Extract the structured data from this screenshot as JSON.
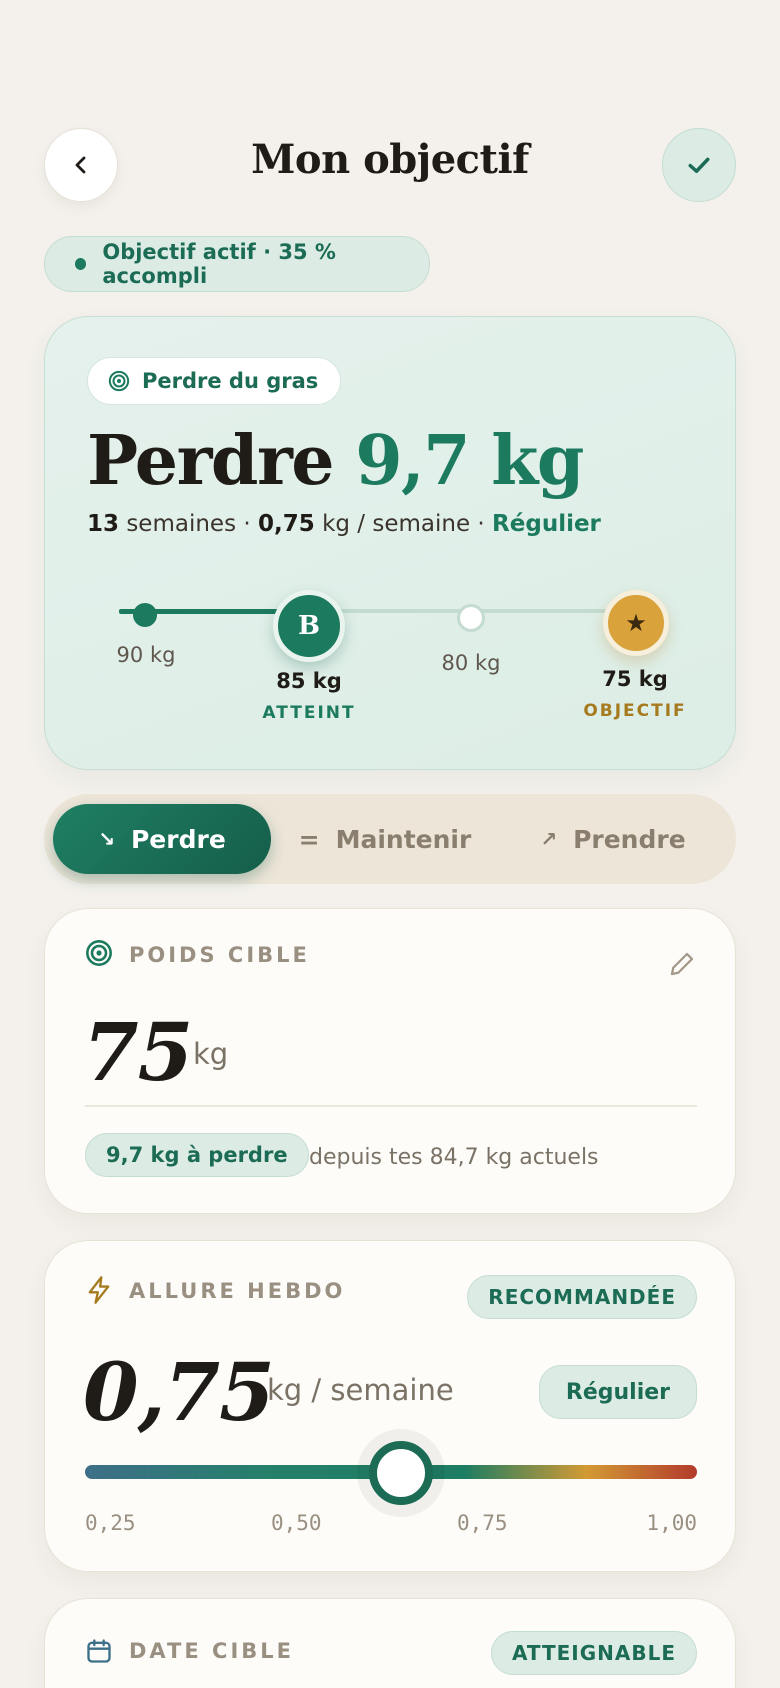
{
  "header": {
    "title": "Mon objectif"
  },
  "status": {
    "text": "Objectif actif · 35 % accompli"
  },
  "hero": {
    "chip": "Perdre du gras",
    "title_prefix": "Perdre",
    "title_amount": "9,7 kg",
    "weeks": "13",
    "weeks_label": "semaines",
    "rate": "0,75",
    "rate_label": "kg / semaine",
    "pace": "Régulier",
    "progress_fraction": 0.35,
    "milestones": [
      {
        "label": "90 kg"
      },
      {
        "node": "B",
        "weight": "85 kg",
        "tag": "ATTEINT"
      },
      {
        "label": "80 kg"
      },
      {
        "node": "★",
        "weight": "75 kg",
        "tag": "OBJECTIF"
      }
    ]
  },
  "modes": [
    {
      "label": "Perdre",
      "icon": "↘"
    },
    {
      "label": "Maintenir",
      "icon": "="
    },
    {
      "label": "Prendre",
      "icon": "↗"
    }
  ],
  "target_card": {
    "label": "POIDS CIBLE",
    "value": "75",
    "unit": "kg",
    "badge": "9,7 kg à perdre",
    "note": "depuis tes 84,7 kg actuels"
  },
  "pace_card": {
    "label": "ALLURE HEBDO",
    "badge": "RECOMMANDÉE",
    "value": "0,75",
    "unit": "kg / semaine",
    "pace_button": "Régulier",
    "ticks": [
      "0,25",
      "0,50",
      "0,75",
      "1,00"
    ]
  },
  "date_card": {
    "label": "DATE CIBLE",
    "badge": "ATTEIGNABLE"
  },
  "colors": {
    "accent": "#1c7a5e",
    "gold": "#d9a23a",
    "background": "#f4f1ec"
  }
}
